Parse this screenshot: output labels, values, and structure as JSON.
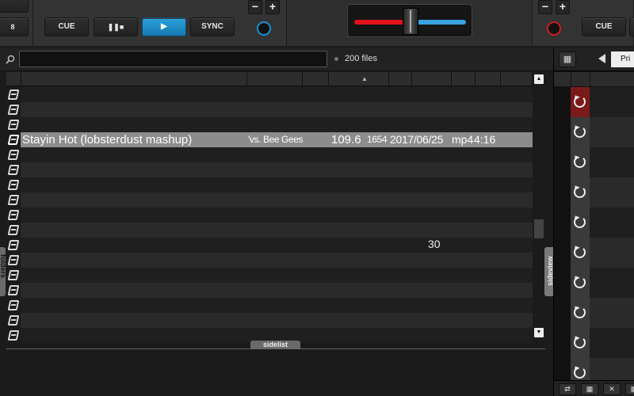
{
  "deck_left": {
    "cue_label": "CUE",
    "pause_label": "❚❚■",
    "play_label": "▶",
    "sync_label": "SYNC",
    "minus_label": "−",
    "plus_label": "+",
    "partial_label": "8",
    "knob_color": "#1a8fd0"
  },
  "crossfader": {
    "left_color": "#e0121a",
    "right_color": "#3aa1e0"
  },
  "deck_right": {
    "cue_label": "CUE",
    "minus_label": "−",
    "plus_label": "+",
    "knob_color": "#d01a1a"
  },
  "browser": {
    "search": {
      "placeholder": "",
      "value": ""
    },
    "file_count": "200 files",
    "sort_indicator": "▲",
    "selected_track": {
      "title": "Stayin Hot (lobsterdust mashup)",
      "artist": "'vs. Bee Gees",
      "bpm": "109.6",
      "plays": "1654",
      "date": "2017/06/25",
      "type": "mp4",
      "length": "4:16"
    },
    "floating_number": "30",
    "tabs": {
      "folders": "folders",
      "sideview": "sideview",
      "sidelist": "sidelist"
    },
    "scroll_up": "▲",
    "scroll_down": "▼"
  },
  "sideview": {
    "select_value": "Pri",
    "grid_icon": "grid-icon",
    "row_icon": "reload-icon",
    "footer_buttons": [
      "⇄",
      "▦",
      "✕",
      "▦"
    ]
  },
  "colors": {
    "accent": "#2aa2dc",
    "selected_row": "#8c8c8c",
    "sideview_first_row": "#7b1a1a"
  }
}
